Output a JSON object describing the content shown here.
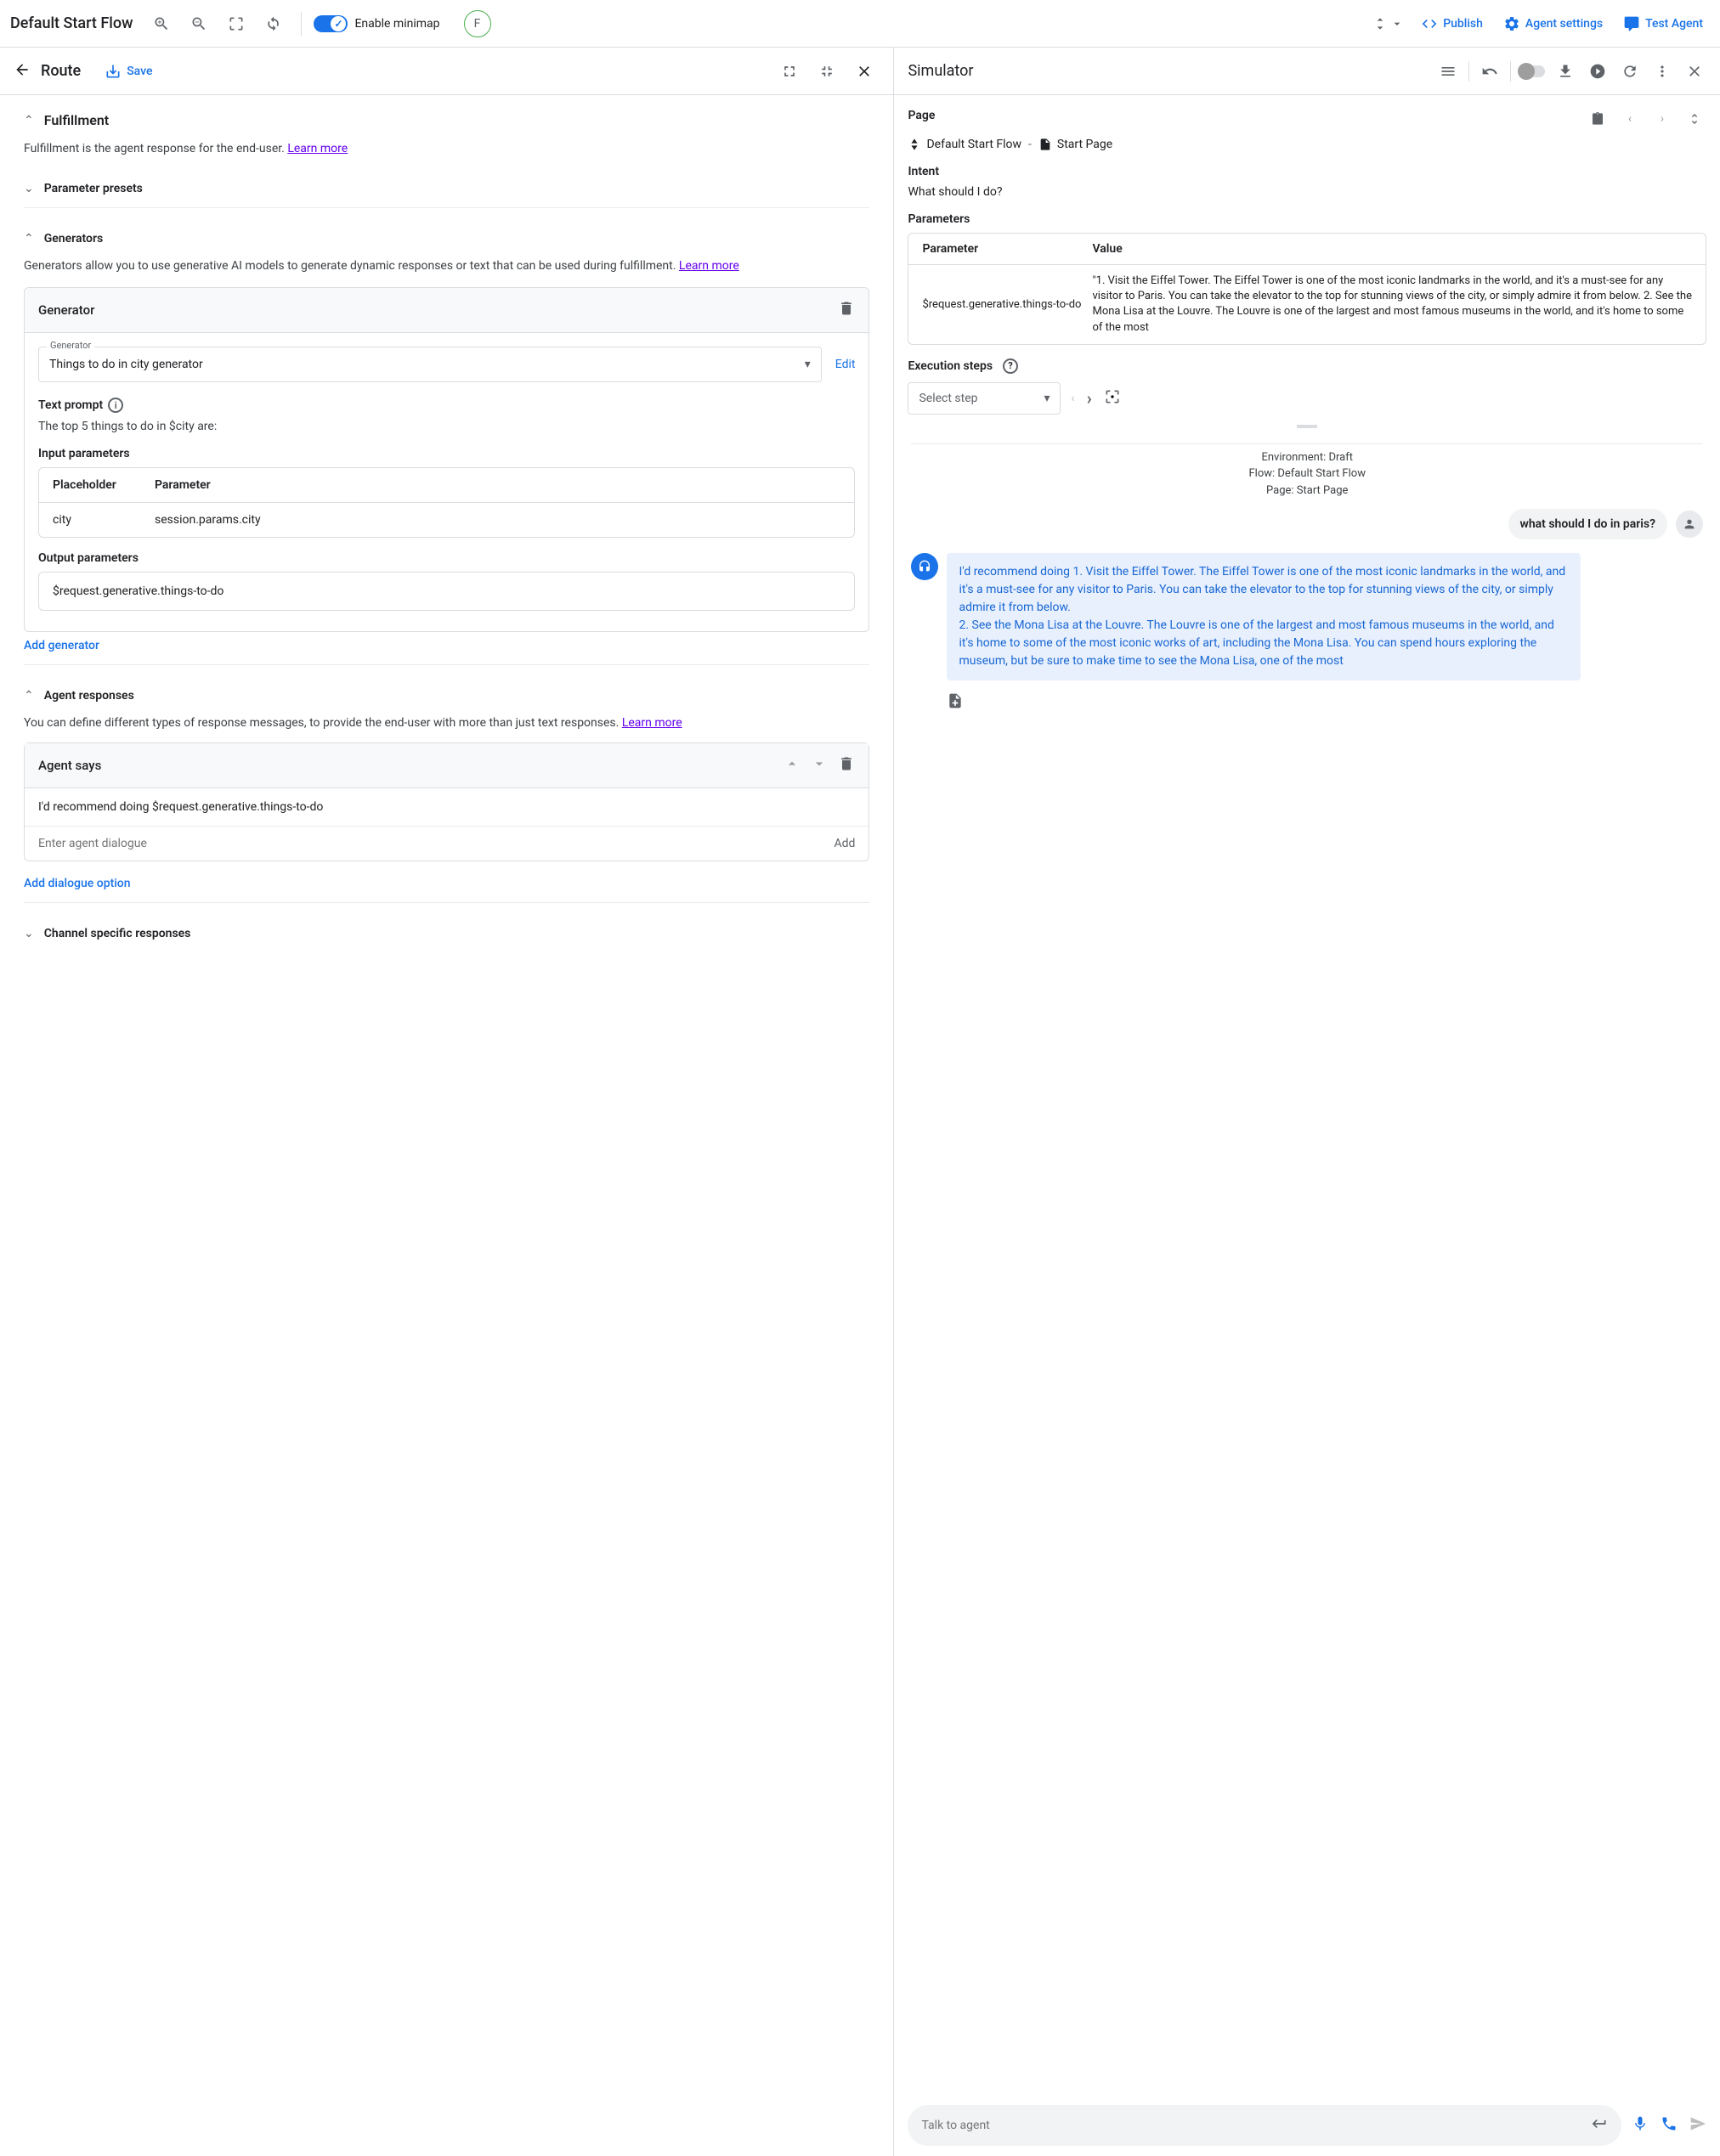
{
  "topbar": {
    "title": "Default Start Flow",
    "enable_minimap": "Enable minimap",
    "avatar_letter": "F",
    "publish": "Publish",
    "agent_settings": "Agent settings",
    "test_agent": "Test Agent"
  },
  "route_panel": {
    "title": "Route",
    "save": "Save",
    "fulfillment": {
      "title": "Fulfillment",
      "desc": "Fulfillment is the agent response for the end-user. ",
      "learn_more": "Learn more",
      "param_presets": "Parameter presets",
      "generators": {
        "title": "Generators",
        "desc": "Generators allow you to use generative AI models to generate dynamic responses or text that can be used during fulfillment. ",
        "learn_more": "Learn more",
        "card_title": "Generator",
        "select_label": "Generator",
        "select_value": "Things to do in city generator",
        "edit": "Edit",
        "text_prompt_label": "Text prompt",
        "text_prompt_value": "The top 5 things to do in $city are:",
        "input_params_label": "Input parameters",
        "placeholder_col": "Placeholder",
        "parameter_col": "Parameter",
        "placeholder_val": "city",
        "parameter_val": "session.params.city",
        "output_params_label": "Output parameters",
        "output_value": "$request.generative.things-to-do",
        "add_generator": "Add generator"
      },
      "agent_responses": {
        "title": "Agent responses",
        "desc": "You can define different types of response messages, to provide the end-user with more than just text responses. ",
        "learn_more": "Learn more",
        "agent_says": "Agent says",
        "response_1": "I'd recommend doing  $request.generative.things-to-do",
        "input_placeholder": "Enter agent dialogue",
        "add_btn": "Add",
        "add_dialogue": "Add dialogue option"
      },
      "channel_specific": "Channel specific responses"
    }
  },
  "simulator": {
    "title": "Simulator",
    "page_label": "Page",
    "flow_name": "Default Start Flow",
    "page_name": "Start Page",
    "intent_label": "Intent",
    "intent_value": "What should I do?",
    "parameters_label": "Parameters",
    "param_col": "Parameter",
    "value_col": "Value",
    "param_name": "$request.generative.things-to-do",
    "param_value": "\"1. Visit the Eiffel Tower. The Eiffel Tower is one of the most iconic landmarks in the world, and it's a must-see for any visitor to Paris. You can take the elevator to the top for stunning views of the city, or simply admire it from below. 2. See the Mona Lisa at the Louvre. The Louvre is one of the largest and most famous museums in the world, and it's home to some of the most",
    "exec_steps": "Execution steps",
    "select_step": "Select step",
    "env_line1": "Environment: Draft",
    "env_line2": "Flow: Default Start Flow",
    "env_line3": "Page: Start Page",
    "user_msg": "what should I do in paris?",
    "bot_msg": "I'd recommend doing 1. Visit the Eiffel Tower. The Eiffel Tower is one of the most iconic landmarks in the world, and it's a must-see for any visitor to Paris. You can take the elevator to the top for stunning views of the city, or simply admire it from below.\n2. See the Mona Lisa at the Louvre. The Louvre is one of the largest and most famous museums in the world, and it's home to some of the most iconic works of art, including the Mona Lisa. You can spend hours exploring the museum, but be sure to make time to see the Mona Lisa, one of the most",
    "talk_placeholder": "Talk to agent"
  }
}
